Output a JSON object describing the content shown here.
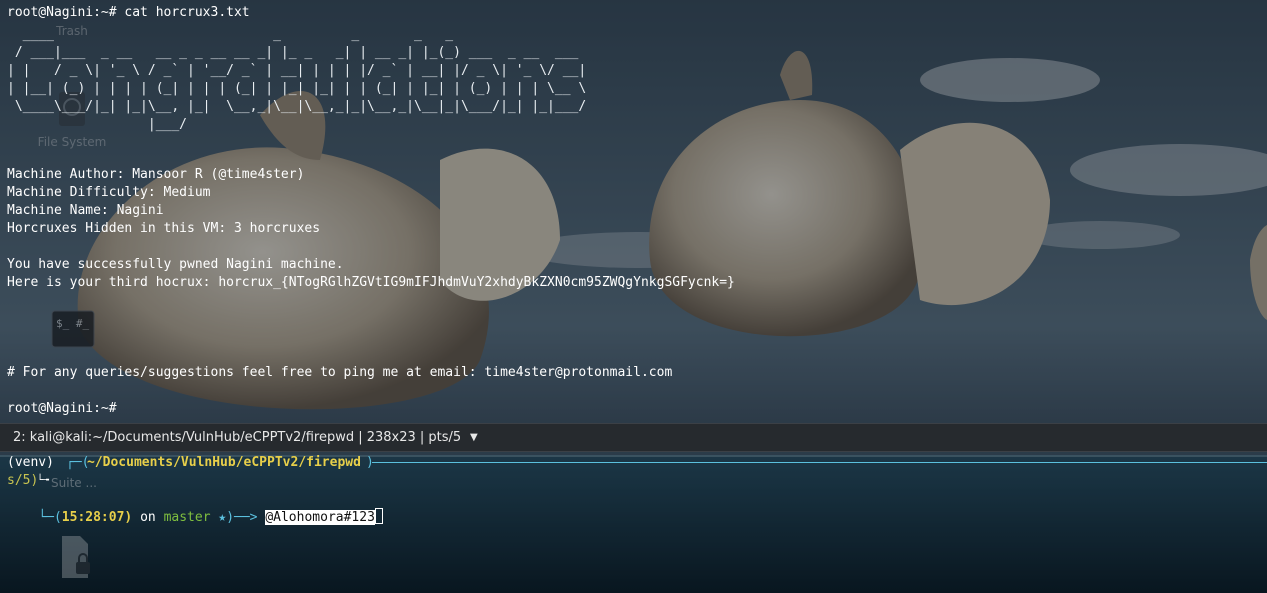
{
  "desktop": {
    "icons": [
      {
        "label": "Trash",
        "icon": "trash-icon"
      },
      {
        "label": "File System",
        "icon": "drive-icon"
      },
      {
        "label": "",
        "icon": "terminal-icon"
      },
      {
        "label": "Suite ...",
        "icon": "app-icon"
      },
      {
        "label": "",
        "icon": "locked-file-icon"
      }
    ]
  },
  "top_terminal": {
    "command_line": "root@Nagini:~# cat horcrux3.txt",
    "banner": "  ____                            _         _       _   _                 \n / ___|___  _ __   __ _ _ __ __ _| |_ _   _| | __ _| |_(_) ___  _ __  ___ \n| |   / _ \\| '_ \\ / _` | '__/ _` | __| | | | |/ _` | __| |/ _ \\| '_ \\/ __|\n| |__| (_) | | | | (_| | | | (_| | |_| |_| | | (_| | |_| | (_) | | | \\__ \\\n \\____\\___/|_| |_|\\__, |_|  \\__,_|\\__|\\__,_|_|\\__,_|\\__|_|\\___/|_| |_|___/\n                  |___/                                                  ",
    "author": "Machine Author: Mansoor R (@time4ster)",
    "difficulty": "Machine Difficulty: Medium",
    "name": "Machine Name: Nagini",
    "horcruxes": "Horcruxes Hidden in this VM: 3 horcruxes",
    "success": "You have successfully pwned Nagini machine.",
    "third": "Here is your third hocrux: horcrux_{NTogRGlhZGVtIG9mIFJhdmVuY2xhdyBkZXN0cm95ZWQgYnkgSGFycnk=}",
    "contact": "# For any queries/suggestions feel free to ping me at email: time4ster@protonmail.com",
    "prompt": "root@Nagini:~#"
  },
  "tab_bar": {
    "title": "2: kali@kali:~/Documents/VulnHub/eCPPTv2/firepwd | 238x23 | pts/5",
    "caret": "▼"
  },
  "bottom_terminal": {
    "venv": "(venv)",
    "path_open": "┌─(",
    "path": "~/Documents/VulnHub/eCPPTv2/firepwd",
    "path_close": ")",
    "wrap": "s/5)",
    "wrap_tail": "└╼",
    "time_open": "└─(",
    "time": "15:28:07",
    "on": " on ",
    "branch": "master",
    "star": " ★",
    "arrow": ")──> ",
    "typed": "@Alohomora#123"
  },
  "colors": {
    "prompt_yellow": "#e7cf4a",
    "accent_cyan": "#5bc0de",
    "branch_green": "#7fbf3f",
    "tabbar_bg": "#262a2e"
  }
}
